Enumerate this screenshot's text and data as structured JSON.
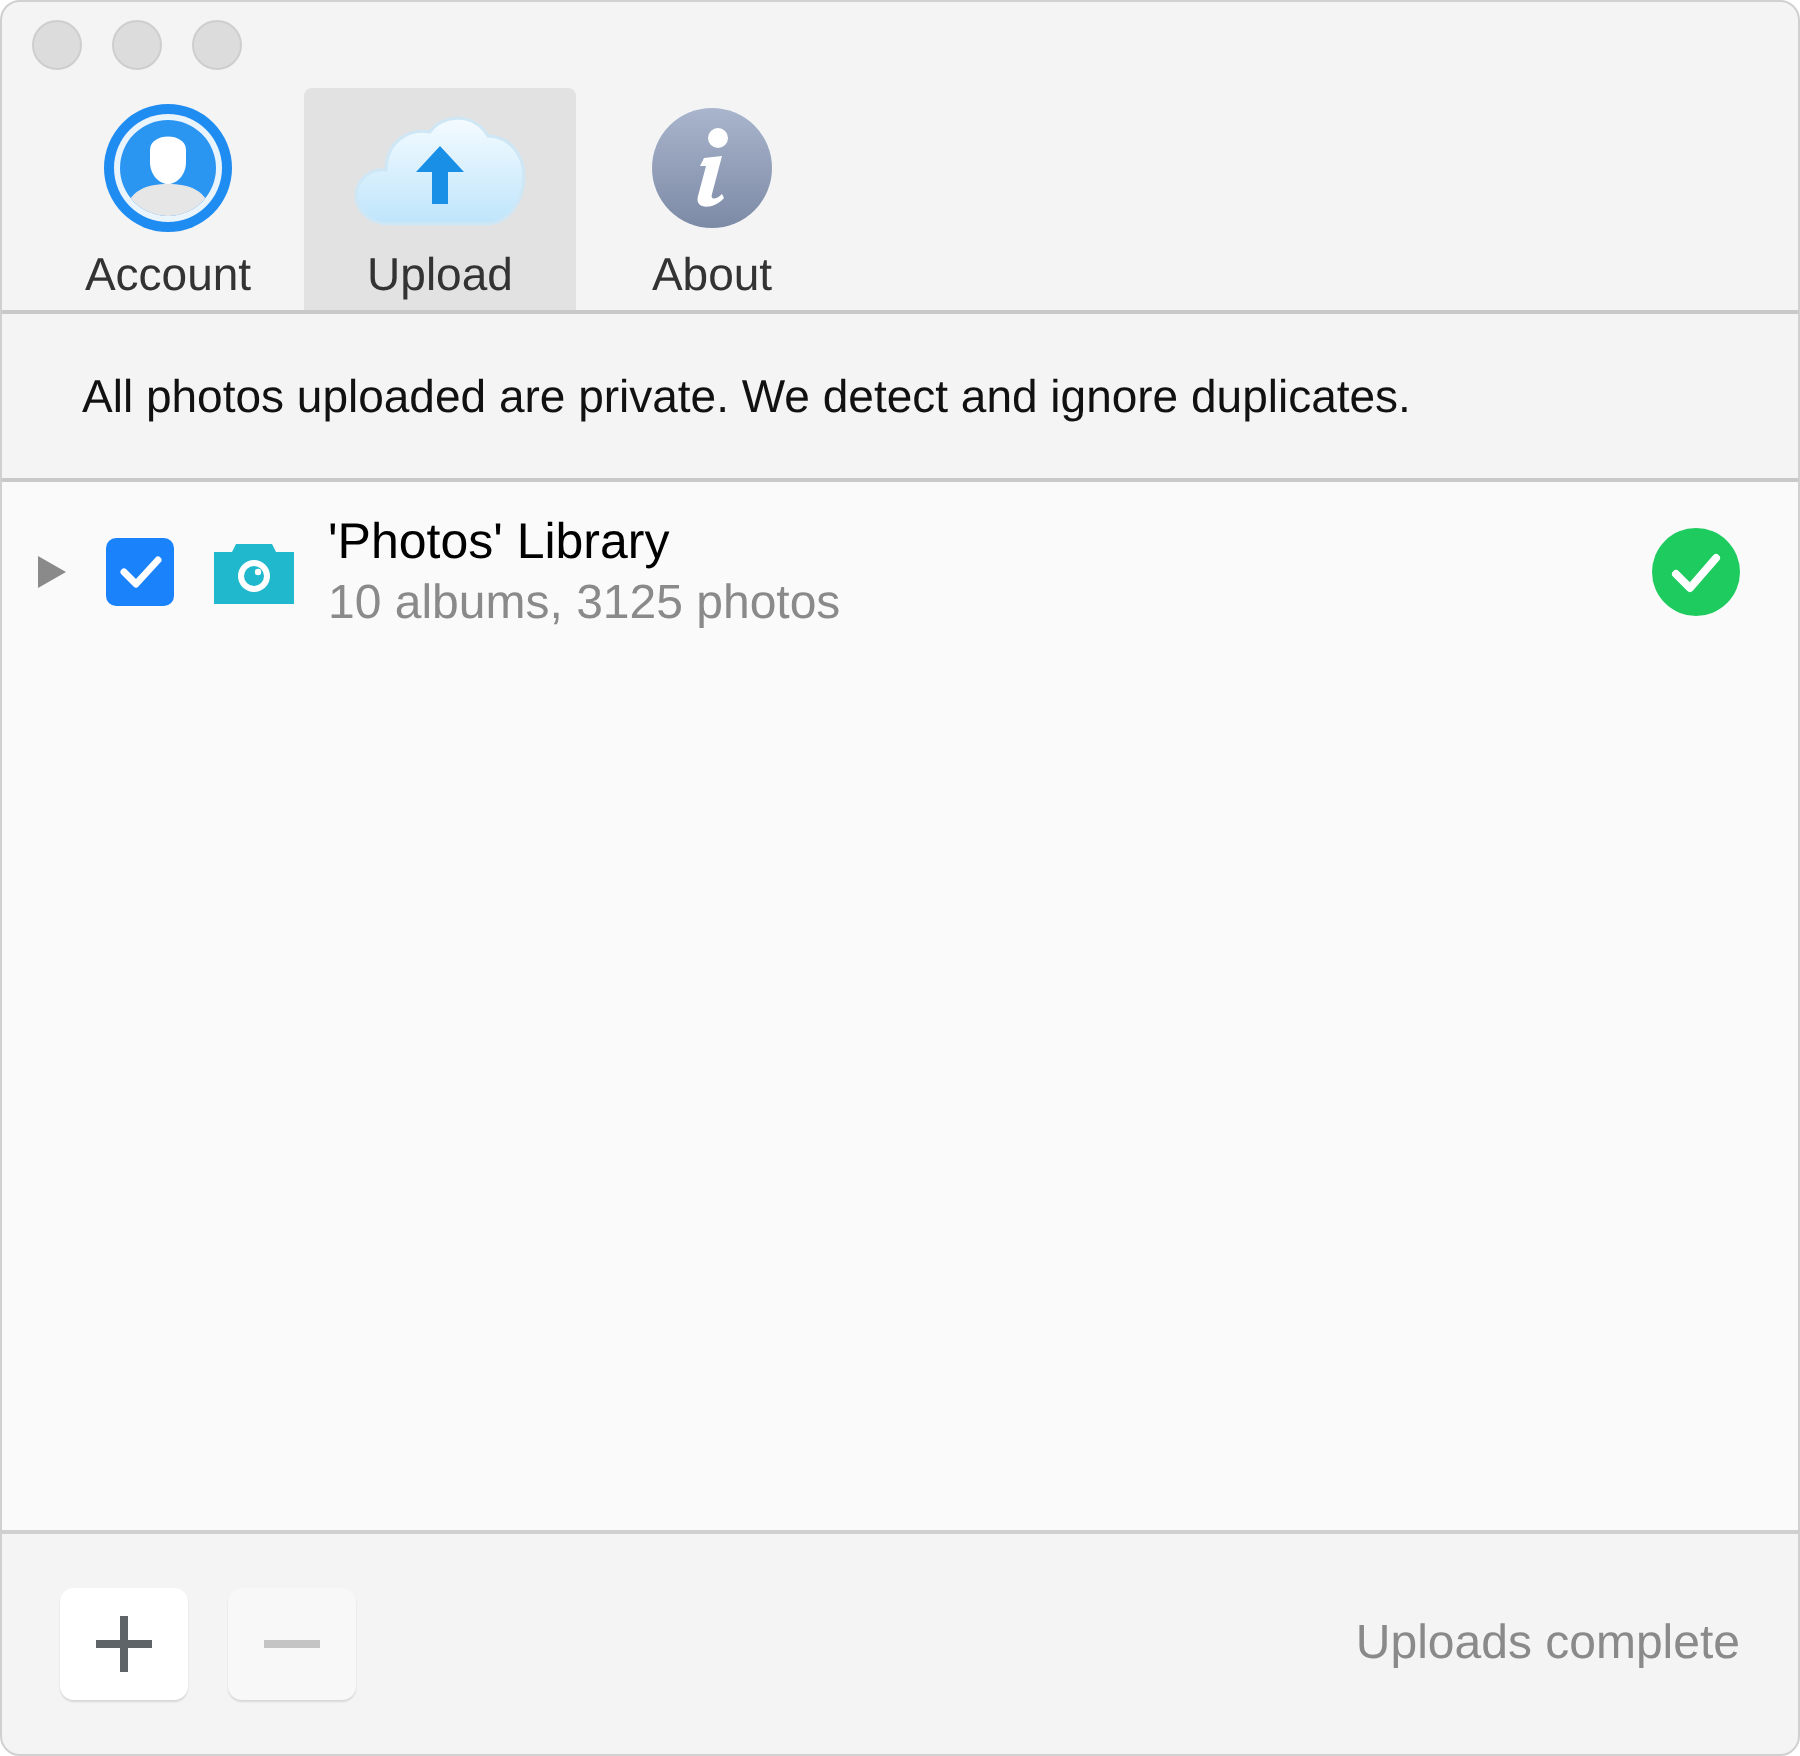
{
  "tabs": [
    {
      "kind": "account",
      "label": "Account",
      "selected": false
    },
    {
      "kind": "upload",
      "label": "Upload",
      "selected": true
    },
    {
      "kind": "about",
      "label": "About",
      "selected": false
    }
  ],
  "notice": "All photos uploaded are private. We detect and ignore duplicates.",
  "sources": [
    {
      "title": "'Photos' Library",
      "subtitle": "10 albums, 3125 photos",
      "expanded": false,
      "checked": true,
      "uploaded": true
    }
  ],
  "buttons": [
    {
      "kind": "add",
      "disabled": false
    },
    {
      "kind": "remove",
      "disabled": true
    }
  ],
  "status": "Uploads complete"
}
